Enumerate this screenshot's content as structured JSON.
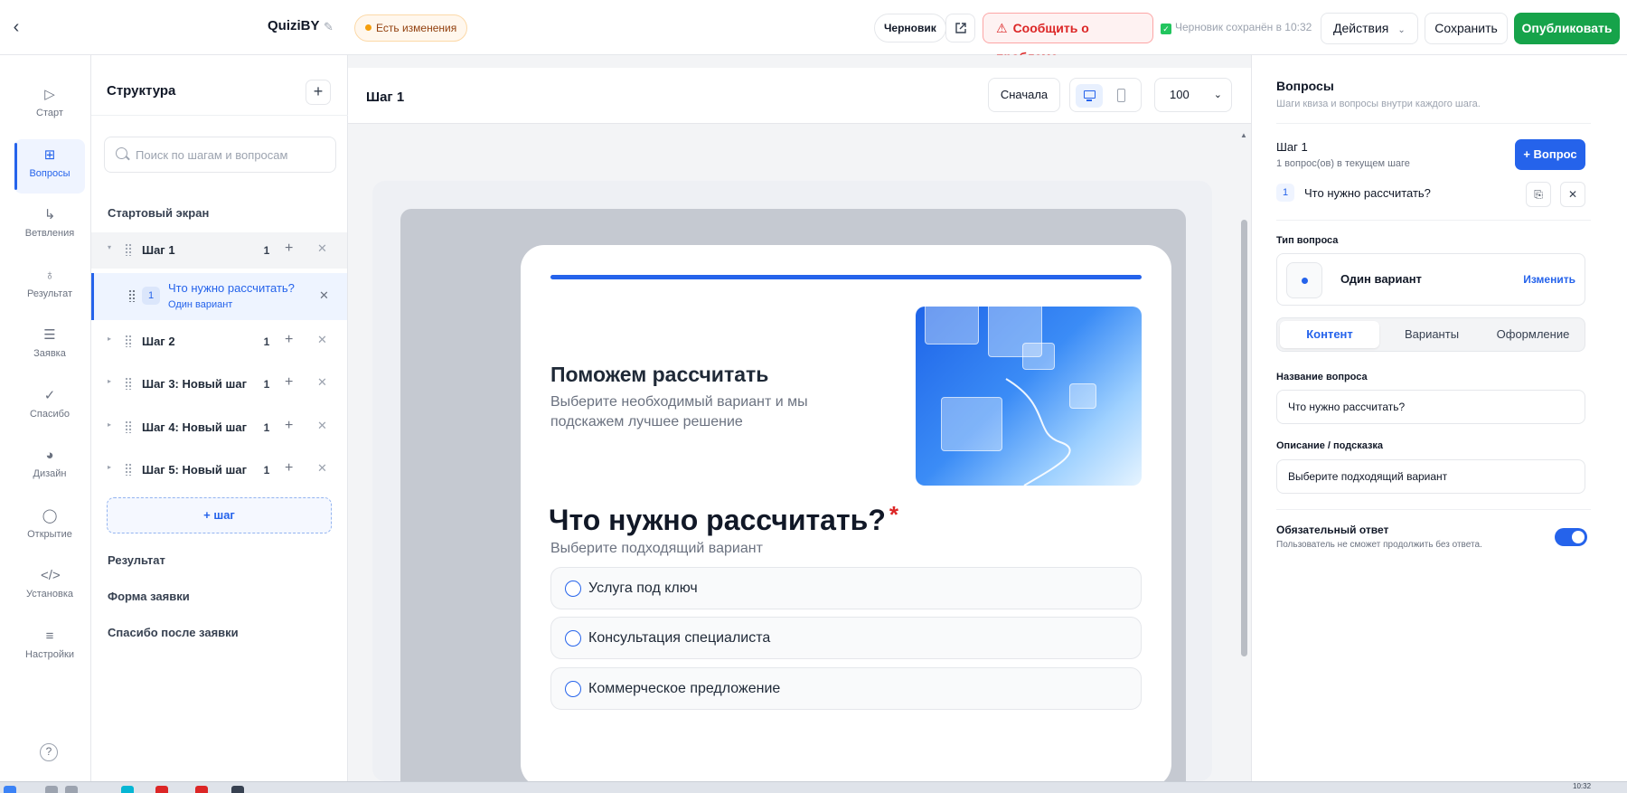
{
  "topbar": {
    "app_title": "QuiziBY",
    "changes_badge": "Есть изменения",
    "draft_label": "Черновик",
    "report_label": "Сообщить о проблеме",
    "saved_status": "Черновик сохранён в 10:32",
    "actions_label": "Действия",
    "save_label": "Сохранить",
    "publish_label": "Опубликовать"
  },
  "nav": {
    "items": [
      {
        "label": "Старт",
        "icon": "play-icon"
      },
      {
        "label": "Вопросы",
        "icon": "grid-icon",
        "active": true
      },
      {
        "label": "Ветвления",
        "icon": "branch-icon"
      },
      {
        "label": "Результат",
        "icon": "award-icon"
      },
      {
        "label": "Заявка",
        "icon": "form-icon"
      },
      {
        "label": "Спасибо",
        "icon": "check-circle-icon"
      },
      {
        "label": "Дизайн",
        "icon": "palette-icon"
      },
      {
        "label": "Открытие",
        "icon": "chat-icon"
      },
      {
        "label": "Установка",
        "icon": "code-icon"
      },
      {
        "label": "Настройки",
        "icon": "menu-icon"
      }
    ],
    "help_glyph": "?"
  },
  "structure": {
    "title": "Структура",
    "search_placeholder": "Поиск по шагам и вопросам",
    "start_screen": "Стартовый экран",
    "steps": [
      {
        "name": "Шаг 1",
        "count": "1"
      },
      {
        "name": "Шаг 2",
        "count": "1"
      },
      {
        "name": "Шаг 3: Новый шаг",
        "count": "1"
      },
      {
        "name": "Шаг 4: Новый шаг",
        "count": "1"
      },
      {
        "name": "Шаг 5: Новый шаг",
        "count": "1"
      }
    ],
    "selected_question": {
      "num": "1",
      "title": "Что нужно рассчитать?",
      "type": "Один вариант"
    },
    "add_step": "+ шаг",
    "result": "Результат",
    "lead_form": "Форма заявки",
    "thanks": "Спасибо после заявки"
  },
  "canvas": {
    "title": "Шаг 1",
    "restart_label": "Сначала",
    "zoom_value": "100",
    "hero_title": "Поможем рассчитать",
    "hero_subtitle": "Выберите необходимый вариант и мы подскажем лучшее решение",
    "question_title": "Что нужно рассчитать?",
    "required_mark": "*",
    "question_subtitle": "Выберите подходящий вариант",
    "options": [
      "Услуга под ключ",
      "Консультация специалиста",
      "Коммерческое предложение"
    ],
    "progress_fraction": 1.0
  },
  "right_panel": {
    "title": "Вопросы",
    "subtitle": "Шаги квиза и вопросы внутри каждого шага.",
    "step_name": "Шаг 1",
    "step_sub": "1 вопрос(ов) в текущем шаге",
    "add_question_label": "+ Вопрос",
    "question_num": "1",
    "question_text": "Что нужно рассчитать?",
    "type_label": "Тип вопроса",
    "type_name": "Один вариант",
    "type_change": "Изменить",
    "tabs": [
      "Контент",
      "Варианты",
      "Оформление"
    ],
    "name_label": "Название вопроса",
    "name_value": "Что нужно рассчитать?",
    "desc_label": "Описание / подсказка",
    "desc_value": "Выберите подходящий вариант",
    "required_label": "Обязательный ответ",
    "required_sub": "Пользователь не сможет продолжить без ответа.",
    "required_on": true
  },
  "taskbar": {
    "clock": "10:32"
  },
  "colors": {
    "accent": "#2563eb",
    "publish": "#16a34a",
    "danger": "#dc2626"
  }
}
